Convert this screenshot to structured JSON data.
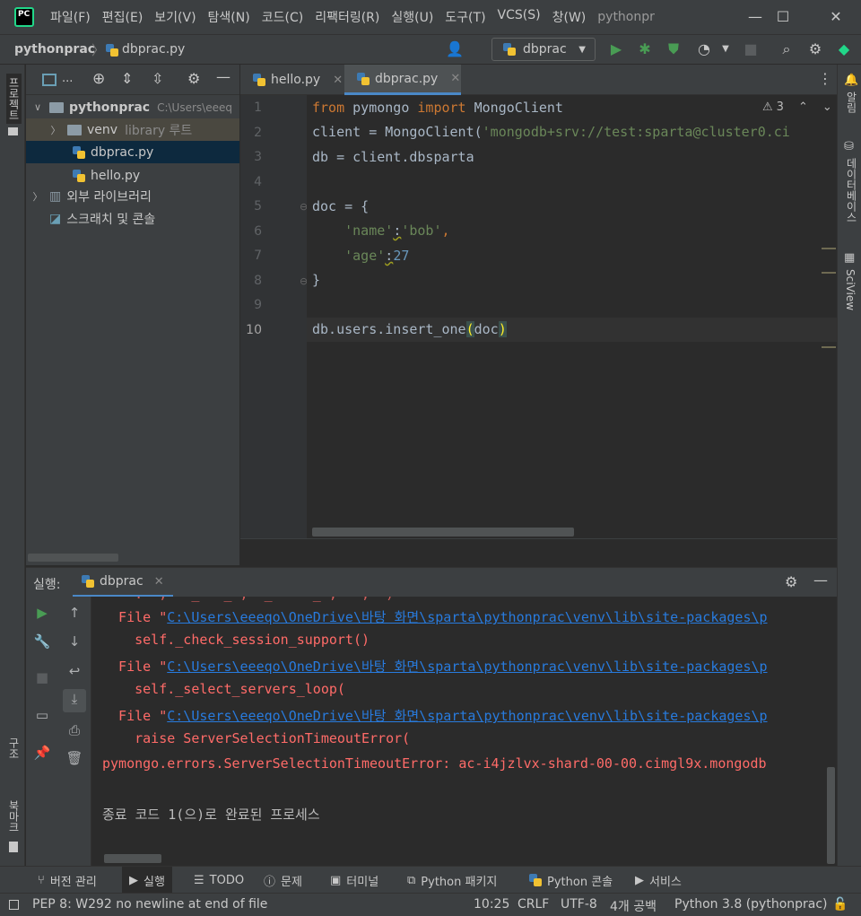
{
  "window": {
    "title": "pythonpr",
    "menu": [
      "파일(F)",
      "편집(E)",
      "보기(V)",
      "탐색(N)",
      "코드(C)",
      "리팩터링(R)",
      "실행(U)",
      "도구(T)",
      "VCS(S)",
      "창(W)"
    ],
    "min_icon": "minimize-icon",
    "max_icon": "maximize-icon",
    "close_icon": "close-icon",
    "min_glyph": "—",
    "max_glyph": "☐",
    "close_glyph": "✕"
  },
  "navbar": {
    "project": "pythonprac",
    "file": "dbprac.py",
    "run_config": "dbprac"
  },
  "left_strip": {
    "project_label": "프로젝트",
    "structure_label": "구조",
    "bookmarks_label": "북마크"
  },
  "right_strip": {
    "notifications_label": "알림",
    "database_label": "데이터베이스",
    "sciview_label": "SciView"
  },
  "project": {
    "header_label": "...",
    "tree": [
      {
        "label": "pythonprac",
        "extra": "C:\\Users\\eeeq",
        "type": "folder",
        "expanded": true
      },
      {
        "label": "venv",
        "extra": "library 루트",
        "type": "folder",
        "expanded": false
      },
      {
        "label": "dbprac.py",
        "type": "python-file",
        "selected": true
      },
      {
        "label": "hello.py",
        "type": "python-file"
      },
      {
        "label": "외부 라이브러리",
        "type": "library",
        "expanded": false
      },
      {
        "label": "스크래치 및 콘솔",
        "type": "scratch"
      }
    ]
  },
  "editor": {
    "tabs": [
      {
        "label": "hello.py",
        "active": false
      },
      {
        "label": "dbprac.py",
        "active": true
      }
    ],
    "warning_count": "3",
    "line_numbers": [
      "1",
      "2",
      "3",
      "4",
      "5",
      "6",
      "7",
      "8",
      "9",
      "10"
    ],
    "lines": [
      {
        "t1": "from",
        "t2": " pymongo ",
        "t3": "import",
        "t4": " MongoClient"
      },
      {
        "t1": "client = MongoClient(",
        "t2": "'mongodb+srv://test:sparta@cluster0.ci"
      },
      {
        "t1": "db = client.dbsparta"
      },
      {
        "t1": ""
      },
      {
        "t1": "doc = {"
      },
      {
        "t1": "    ",
        "t2": "'name'",
        "t3": ":",
        "t4": "'bob'",
        "t5": ","
      },
      {
        "t1": "    ",
        "t2": "'age'",
        "t3": ":",
        "t4": "27"
      },
      {
        "t1": "}"
      },
      {
        "t1": ""
      },
      {
        "t1": "db.users.insert_one",
        "t2": "(",
        "t3": "doc",
        "t4": ")"
      }
    ]
  },
  "run": {
    "label": "실행:",
    "tab": "dbprac",
    "console": [
      {
        "prefix": "  File \"",
        "link": "C:\\Users\\eeeqo\\OneDrive\\바탕 화면\\sparta\\pythonprac\\venv\\lib\\site-packages\\p"
      },
      {
        "text": "    self._check_session_support()"
      },
      {
        "prefix": "  File \"",
        "link": "C:\\Users\\eeeqo\\OneDrive\\바탕 화면\\sparta\\pythonprac\\venv\\lib\\site-packages\\p"
      },
      {
        "text": "    self._select_servers_loop("
      },
      {
        "prefix": "  File \"",
        "link": "C:\\Users\\eeeqo\\OneDrive\\바탕 화면\\sparta\\pythonprac\\venv\\lib\\site-packages\\p"
      },
      {
        "text": "    raise ServerSelectionTimeoutError("
      },
      {
        "text": "pymongo.errors.ServerSelectionTimeoutError: ac-i4jzlvx-shard-00-00.cimgl9x.mongodb"
      }
    ],
    "exit_message": "종료 코드 1(으)로 완료된 프로세스"
  },
  "bottom_tabs": [
    "버전 관리",
    "실행",
    "TODO",
    "문제",
    "터미널",
    "Python 패키지",
    "Python 콘솔",
    "서비스"
  ],
  "status": {
    "message": "PEP 8: W292 no newline at end of file",
    "position": "10:25",
    "line_sep": "CRLF",
    "encoding": "UTF-8",
    "indent": "4개 공백",
    "interpreter": "Python 3.8 (pythonprac)"
  },
  "colors": {
    "keyword": "#cc7832",
    "string": "#6a8759",
    "number": "#6897bb",
    "error": "#ff6b68",
    "link": "#287bde",
    "accent": "#4a88c7"
  }
}
